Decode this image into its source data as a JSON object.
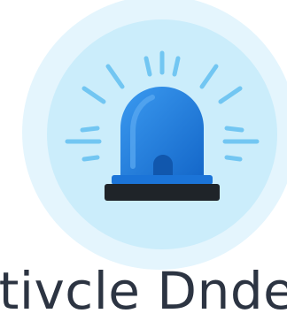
{
  "illustration": {
    "icon": "siren-icon",
    "colors": {
      "outer_circle": "#e2f4fd",
      "inner_circle": "#c9ecfb",
      "rays": "#6cc4f1",
      "dome": "#1e82e4",
      "dome_highlight": "#58a6ee",
      "base": "#1f2429"
    }
  },
  "caption": {
    "text": "tivcle Dnde"
  }
}
